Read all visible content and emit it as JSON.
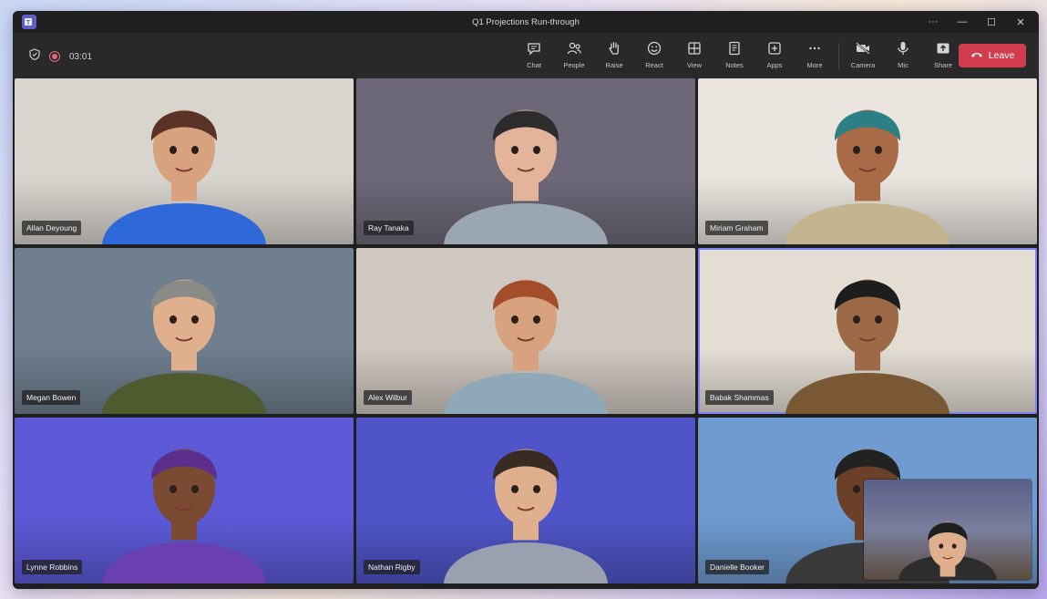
{
  "window": {
    "title": "Q1 Projections Run-through"
  },
  "status": {
    "timer": "03:01"
  },
  "toolbar": {
    "tools": [
      {
        "label": "Chat",
        "icon": "chat-icon"
      },
      {
        "label": "People",
        "icon": "people-icon"
      },
      {
        "label": "Raise",
        "icon": "raise-hand-icon"
      },
      {
        "label": "React",
        "icon": "react-icon"
      },
      {
        "label": "View",
        "icon": "view-icon"
      },
      {
        "label": "Notes",
        "icon": "notes-icon"
      },
      {
        "label": "Apps",
        "icon": "apps-icon"
      },
      {
        "label": "More",
        "icon": "more-icon"
      }
    ],
    "devices": [
      {
        "label": "Camera",
        "icon": "camera-off-icon"
      },
      {
        "label": "Mic",
        "icon": "mic-icon"
      },
      {
        "label": "Share",
        "icon": "share-icon"
      }
    ],
    "leave_label": "Leave"
  },
  "participants": [
    {
      "name": "Allan Deyoung",
      "bg": "#d8d4ce",
      "skin": "#d9a27f",
      "hair": "#5a3326",
      "shirt": "#2f68d8"
    },
    {
      "name": "Ray Tanaka",
      "bg": "#6d6878",
      "skin": "#e3b49a",
      "hair": "#2c2c2c",
      "shirt": "#9aa7b3"
    },
    {
      "name": "Miriam Graham",
      "bg": "#e9e4de",
      "skin": "#a86a47",
      "hair": "#2c7f84",
      "shirt": "#c4b58f"
    },
    {
      "name": "Megan Bowen",
      "bg": "#6f7f8f",
      "skin": "#e0b08e",
      "hair": "#8a8a86",
      "shirt": "#4f5a2e"
    },
    {
      "name": "Alex Wilbur",
      "bg": "#cfc8c0",
      "skin": "#d9a27f",
      "hair": "#a34d2a",
      "shirt": "#8fa8b8"
    },
    {
      "name": "Babak Shammas",
      "bg": "#e3ddd4",
      "skin": "#9c6a47",
      "hair": "#1d1d1d",
      "shirt": "#7b5834"
    },
    {
      "name": "Lynne Robbins",
      "bg": "#5d5ad8",
      "skin": "#7a4a32",
      "hair": "#5c2f8f",
      "shirt": "#6a3fb0"
    },
    {
      "name": "Nathan Rigby",
      "bg": "#4f55c8",
      "skin": "#e0b08e",
      "hair": "#3a2a24",
      "shirt": "#9aa0b0"
    },
    {
      "name": "Danielle Booker",
      "bg": "#6f9bd0",
      "skin": "#6b4028",
      "hair": "#222222",
      "shirt": "#3a3a3a"
    }
  ]
}
